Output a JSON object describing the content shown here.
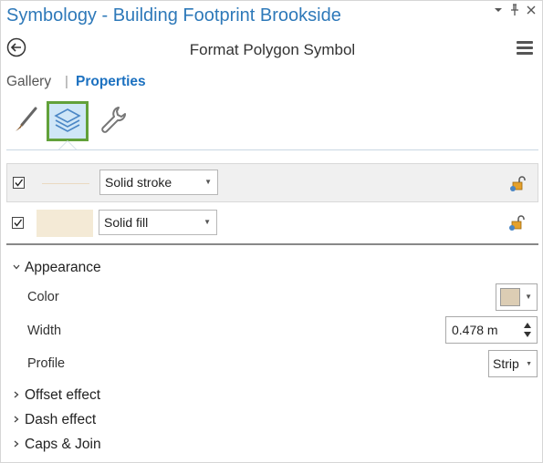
{
  "window": {
    "title": "Symbology - Building Footprint Brookside",
    "pin_glyph": "▾ ᵖ",
    "close_glyph": "✕"
  },
  "header": {
    "title": "Format Polygon Symbol",
    "back_icon": "back-arrow-icon",
    "menu_icon": "hamburger-menu-icon"
  },
  "tabs": {
    "gallery": "Gallery",
    "separator": "|",
    "properties": "Properties",
    "active": "Properties"
  },
  "toolbar": {
    "tools": [
      {
        "icon": "paintbrush-icon",
        "selected": false
      },
      {
        "icon": "layers-icon",
        "selected": true
      },
      {
        "icon": "wrench-icon",
        "selected": false
      }
    ]
  },
  "layers": [
    {
      "checked": true,
      "type": "Solid stroke",
      "swatch_color": "#ead9c0",
      "selected": true
    },
    {
      "checked": true,
      "type": "Solid fill",
      "swatch_color": "#f4ead6",
      "selected": false
    }
  ],
  "appearance": {
    "heading": "Appearance",
    "expanded": true,
    "color_label": "Color",
    "color_value": "#dccdb4",
    "width_label": "Width",
    "width_value": "0.478 m",
    "profile_label": "Profile",
    "profile_value": "Strip"
  },
  "sections": [
    {
      "label": "Offset effect",
      "expanded": false
    },
    {
      "label": "Dash effect",
      "expanded": false
    },
    {
      "label": "Caps & Join",
      "expanded": false
    }
  ],
  "colors": {
    "title_blue": "#2e79b9",
    "tab_active": "#1c71c0",
    "selection_border": "#62a13a",
    "selection_fill": "#cfe6f7"
  }
}
